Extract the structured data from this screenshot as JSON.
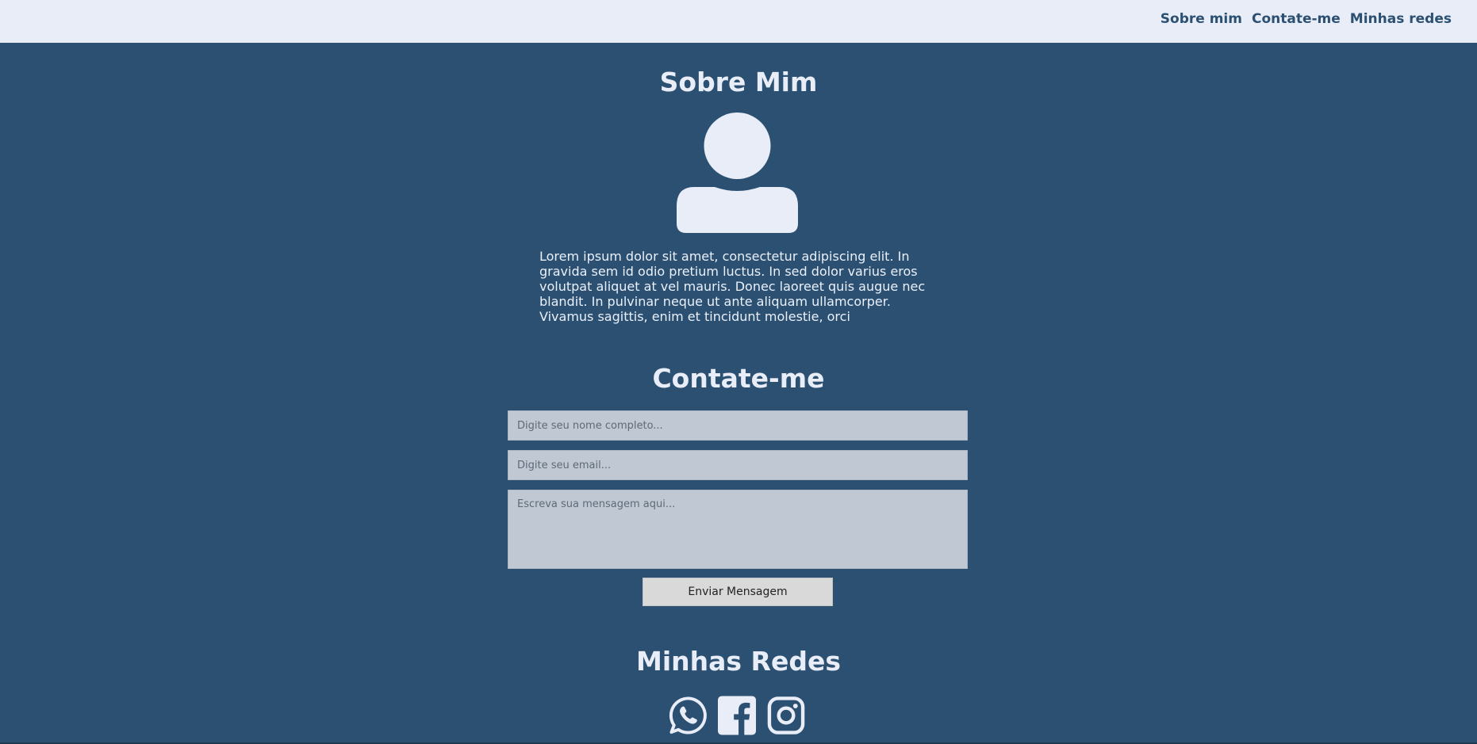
{
  "nav": {
    "items": [
      {
        "label": "Sobre mim"
      },
      {
        "label": "Contate-me"
      },
      {
        "label": "Minhas redes"
      }
    ]
  },
  "about": {
    "title": "Sobre Mim",
    "avatar_icon": "user-icon",
    "text": "Lorem ipsum dolor sit amet, consectetur adipiscing elit. In gravida sem id odio pretium luctus. In sed dolor varius eros volutpat aliquet at vel mauris. Donec laoreet quis augue nec blandit. In pulvinar neque ut ante aliquam ullamcorper. Vivamus sagittis, enim et tincidunt molestie, orci"
  },
  "contact": {
    "title": "Contate-me",
    "name_placeholder": "Digite seu nome completo...",
    "name_value": "",
    "email_placeholder": "Digite seu email...",
    "email_value": "",
    "message_placeholder": "Escreva sua mensagem aqui...",
    "message_value": "",
    "submit_label": "Enviar Mensagem"
  },
  "networks": {
    "title": "Minhas Redes",
    "icons": [
      "whatsapp-icon",
      "facebook-icon",
      "instagram-icon"
    ]
  },
  "colors": {
    "background": "#2c5072",
    "header_bg": "#e8edf8",
    "text_light": "#e8edf8",
    "input_bg": "#bfc8d3",
    "button_bg": "#d9d9d9"
  }
}
